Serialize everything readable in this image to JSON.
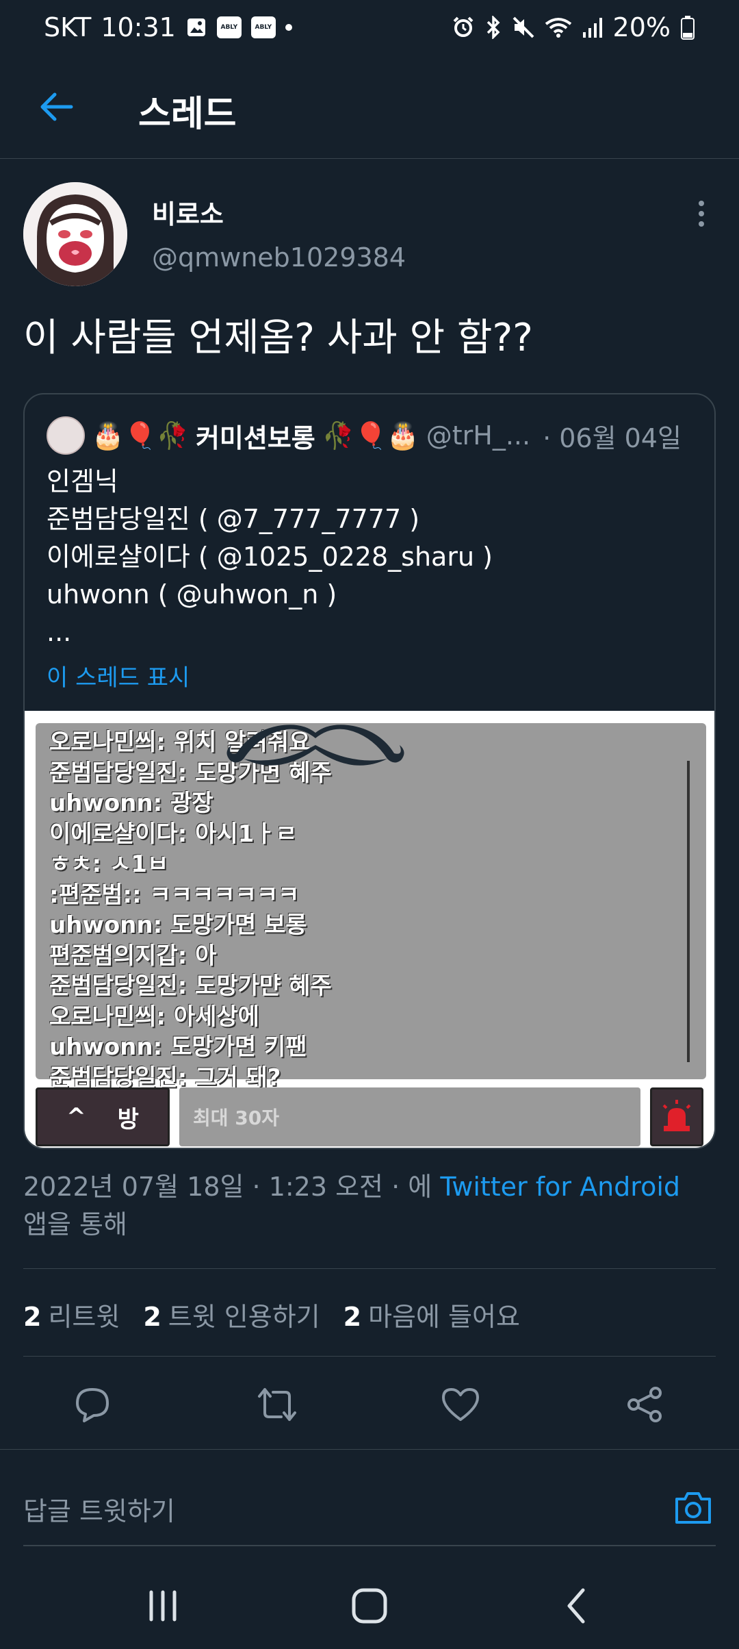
{
  "status_bar": {
    "carrier": "SKT",
    "time": "10:31",
    "badge_1": "ABLY",
    "badge_2": "ABLY",
    "battery": "20%"
  },
  "header": {
    "title": "스레드"
  },
  "tweet": {
    "author_name": "비로소",
    "author_handle": "@qmwneb1029384",
    "text": "이 사람들 언제옴? 사과 안 함??",
    "timestamp": "2022년 07월 18일 · 1:23 오전 · 에",
    "source": "Twitter for Android",
    "source_suffix": "앱을 통해"
  },
  "quote": {
    "emoji_prefix": "🎂🎈🥀",
    "name": "커미션보롱",
    "emoji_suffix": "🥀🎈🎂",
    "handle": "@trH_...",
    "date": "· 06월 04일",
    "lines": [
      "인겜닉",
      "준범담당일진 ( @7_777_7777 )",
      "이에로샬이다 ( @1025_0228_sharu )",
      "uhwonn ( @uhwon_n )",
      "..."
    ],
    "show_thread": "이 스레드 표시"
  },
  "chat_image": {
    "lines": [
      "오로나민씌: 위치 알려줘요",
      "준범담당일진: 도망가면 혜주",
      "uhwonn: 광장",
      "이에로샬이다: 아시1ㅏㄹ",
      "ㅎㅊ: ㅅ1ㅂ",
      ":편준범:: ㅋㅋㅋㅋㅋㅋㅋ",
      "uhwonn: 도망가면 보롱",
      "편준범의지갑: 아",
      "준범담당일진: 도망가먄 혜주",
      "오로나민씌: 아세상에",
      "uhwonn: 도망가면 키팬",
      "준범담당일진: 그거 돼?"
    ],
    "room_arrow": "^",
    "room_label": "방",
    "input_placeholder": "최대 30자"
  },
  "stats": {
    "retweets_count": "2",
    "retweets_label": "리트윗",
    "quotes_count": "2",
    "quotes_label": "트윗 인용하기",
    "likes_count": "2",
    "likes_label": "마음에 들어요"
  },
  "reply": {
    "placeholder": "답글 트윗하기"
  },
  "colors": {
    "background": "#15202b",
    "accent": "#1d9bf0",
    "muted": "#8b98a5",
    "border": "#38444d"
  }
}
